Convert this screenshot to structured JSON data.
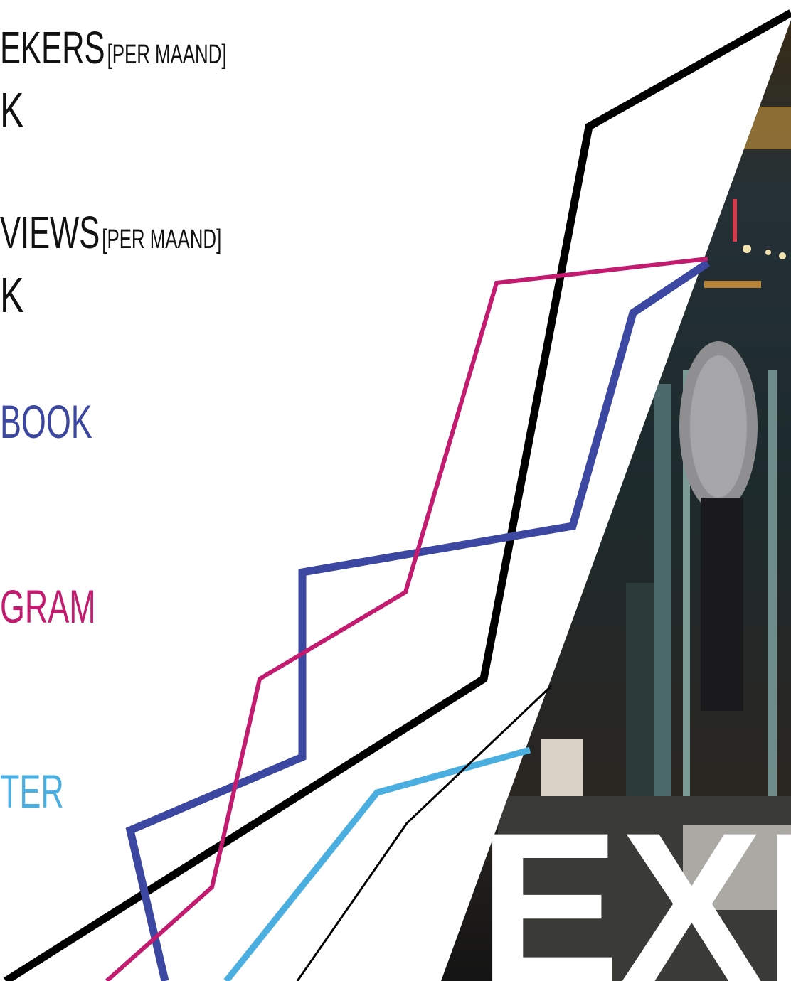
{
  "stats": {
    "visitors_label": "EKERS",
    "visitors_period": "[PER MAAND]",
    "visitors_value": "K",
    "pageviews_label": "VIEWS",
    "pageviews_period": "[PER MAAND]",
    "pageviews_value": "K"
  },
  "channels": {
    "facebook": "BOOK",
    "instagram": "GRAM",
    "twitter": "TER"
  },
  "headline": "EXP",
  "colors": {
    "black_line": "#000000",
    "facebook_line": "#3b47a0",
    "instagram_line": "#c21b6f",
    "twitter_line": "#4aaee0"
  }
}
